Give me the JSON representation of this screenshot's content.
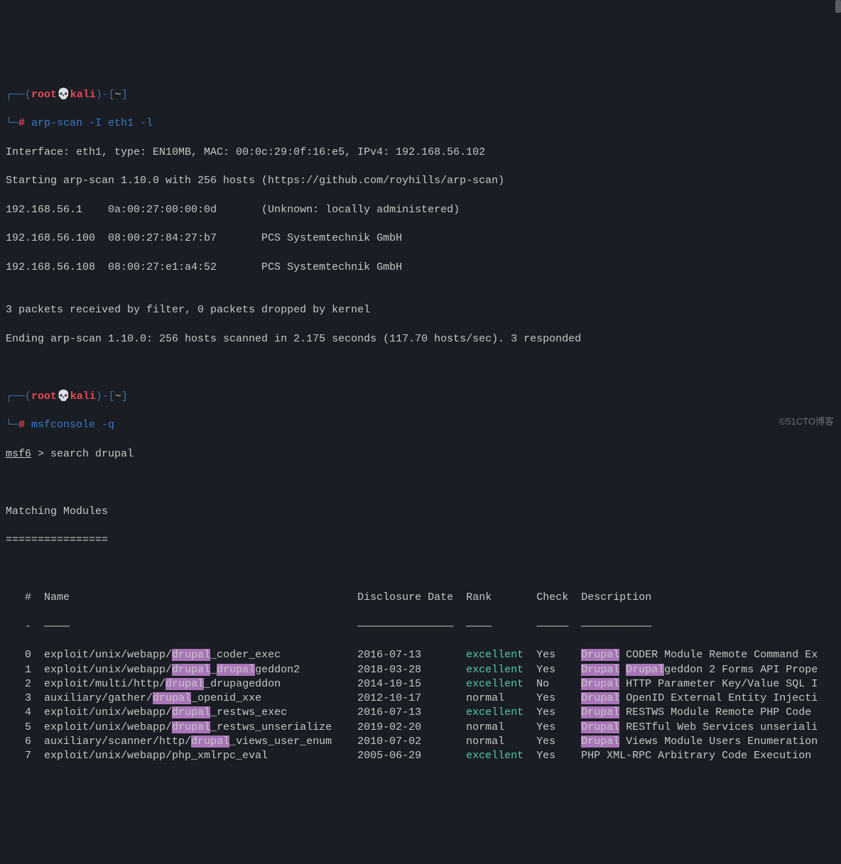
{
  "prompt1": {
    "open": "┌──(",
    "root": "root",
    "skull": "💀",
    "host": "kali",
    "close": ")-[",
    "tilde": "~",
    "close2": "]",
    "line2": "└─",
    "hash": "#",
    "cmd": " arp-scan -I eth1 -l"
  },
  "arp_output": {
    "l1": "Interface: eth1, type: EN10MB, MAC: 00:0c:29:0f:16:e5, IPv4: 192.168.56.102",
    "l2": "Starting arp-scan 1.10.0 with 256 hosts (https://github.com/royhills/arp-scan)",
    "l3": "192.168.56.1    0a:00:27:00:00:0d       (Unknown: locally administered)",
    "l4": "192.168.56.100  08:00:27:84:27:b7       PCS Systemtechnik GmbH",
    "l5": "192.168.56.108  08:00:27:e1:a4:52       PCS Systemtechnik GmbH",
    "l6": "",
    "l7": "3 packets received by filter, 0 packets dropped by kernel",
    "l8": "Ending arp-scan 1.10.0: 256 hosts scanned in 2.175 seconds (117.70 hosts/sec). 3 responded"
  },
  "prompt2": {
    "cmd": " msfconsole -q"
  },
  "msf": {
    "prompt": "msf6",
    "gt": " > ",
    "cmd": "search drupal"
  },
  "matching": {
    "title": "Matching Modules",
    "underline": "================"
  },
  "headers": {
    "num": "#",
    "name": "Name",
    "date": "Disclosure Date",
    "rank": "Rank",
    "check": "Check",
    "desc": "Description"
  },
  "underlines": {
    "num": "-",
    "name": "————",
    "date": "———————————————",
    "rank": "————",
    "check": "—————",
    "desc": "———————————"
  },
  "rows": [
    {
      "num": "0",
      "pre": "exploit/unix/webapp/",
      "hl": "drupal",
      "post": "_coder_exec",
      "date": "2016-07-13",
      "rank": "excellent",
      "check": "Yes",
      "dhl": "Drupal",
      "dtext": " CODER Module Remote Command Ex"
    },
    {
      "num": "1",
      "pre": "exploit/unix/webapp/",
      "hl": "drupal",
      "mid": "_",
      "hl2": "drupal",
      "post": "geddon2",
      "date": "2018-03-28",
      "rank": "excellent",
      "check": "Yes",
      "dhl": "Drupal",
      "dtext2": " ",
      "dhl2": "Drupal",
      "dtext": "geddon 2 Forms API Prope"
    },
    {
      "num": "2",
      "pre": "exploit/multi/http/",
      "hl": "drupal",
      "post": "_drupageddon",
      "date": "2014-10-15",
      "rank": "excellent",
      "check": "No",
      "dhl": "Drupal",
      "dtext": " HTTP Parameter Key/Value SQL I"
    },
    {
      "num": "3",
      "pre": "auxiliary/gather/",
      "hl": "drupal",
      "post": "_openid_xxe",
      "date": "2012-10-17",
      "rank": "normal",
      "check": "Yes",
      "dhl": "Drupal",
      "dtext": " OpenID External Entity Injecti"
    },
    {
      "num": "4",
      "pre": "exploit/unix/webapp/",
      "hl": "drupal",
      "post": "_restws_exec",
      "date": "2016-07-13",
      "rank": "excellent",
      "check": "Yes",
      "dhl": "Drupal",
      "dtext": " RESTWS Module Remote PHP Code "
    },
    {
      "num": "5",
      "pre": "exploit/unix/webapp/",
      "hl": "drupal",
      "post": "_restws_unserialize",
      "date": "2019-02-20",
      "rank": "normal",
      "check": "Yes",
      "dhl": "Drupal",
      "dtext": " RESTful Web Services unseriali"
    },
    {
      "num": "6",
      "pre": "auxiliary/scanner/http/",
      "hl": "drupal",
      "post": "_views_user_enum",
      "date": "2010-07-02",
      "rank": "normal",
      "check": "Yes",
      "dhl": "Drupal",
      "dtext": " Views Module Users Enumeration"
    },
    {
      "num": "7",
      "pre": "exploit/unix/webapp/php_xmlrpc_eval",
      "hl": "",
      "post": "",
      "date": "2005-06-29",
      "rank": "excellent",
      "check": "Yes",
      "dhl": "",
      "dtext": "PHP XML-RPC Arbitrary Code Execution"
    }
  ],
  "watermark": "©51CTO博客"
}
